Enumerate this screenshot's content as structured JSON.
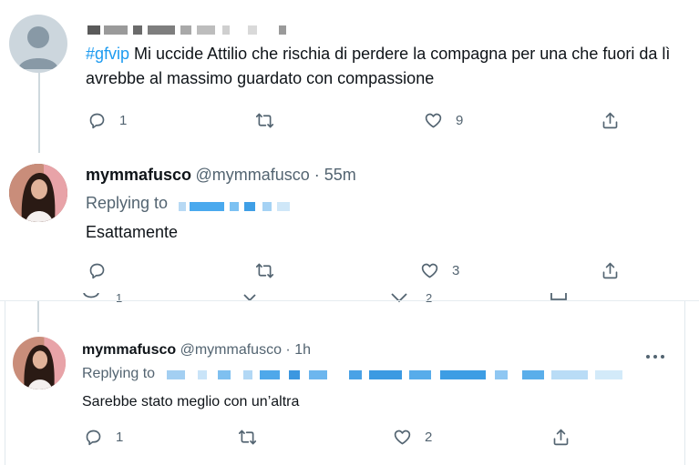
{
  "tweet1": {
    "hashtag": "#gfvip",
    "text": " Mi uccide Attilio che rischia di perdere la compagna per una che fuori da lì avrebbe al massimo guardato con compassione",
    "actions": {
      "replies": "1",
      "likes": "9"
    }
  },
  "tweet2": {
    "name": "mymmafusco",
    "handle": "@mymmafusco · 55m",
    "replying": "Replying to",
    "text": "Esattamente",
    "actions": {
      "likes": "3"
    }
  },
  "tweet3": {
    "name": "mymmafusco",
    "handle": "@mymmafusco · 1h",
    "replying": "Replying to",
    "text": "Sarebbe stato meglio con un’altra",
    "actions": {
      "replies": "1",
      "likes": "2"
    }
  },
  "icons": [
    "reply-icon",
    "retweet-icon",
    "like-icon",
    "share-icon",
    "more-icon"
  ],
  "colors": {
    "link": "#1d9bf0",
    "muted": "#536471",
    "divider": "#cfd9de"
  }
}
